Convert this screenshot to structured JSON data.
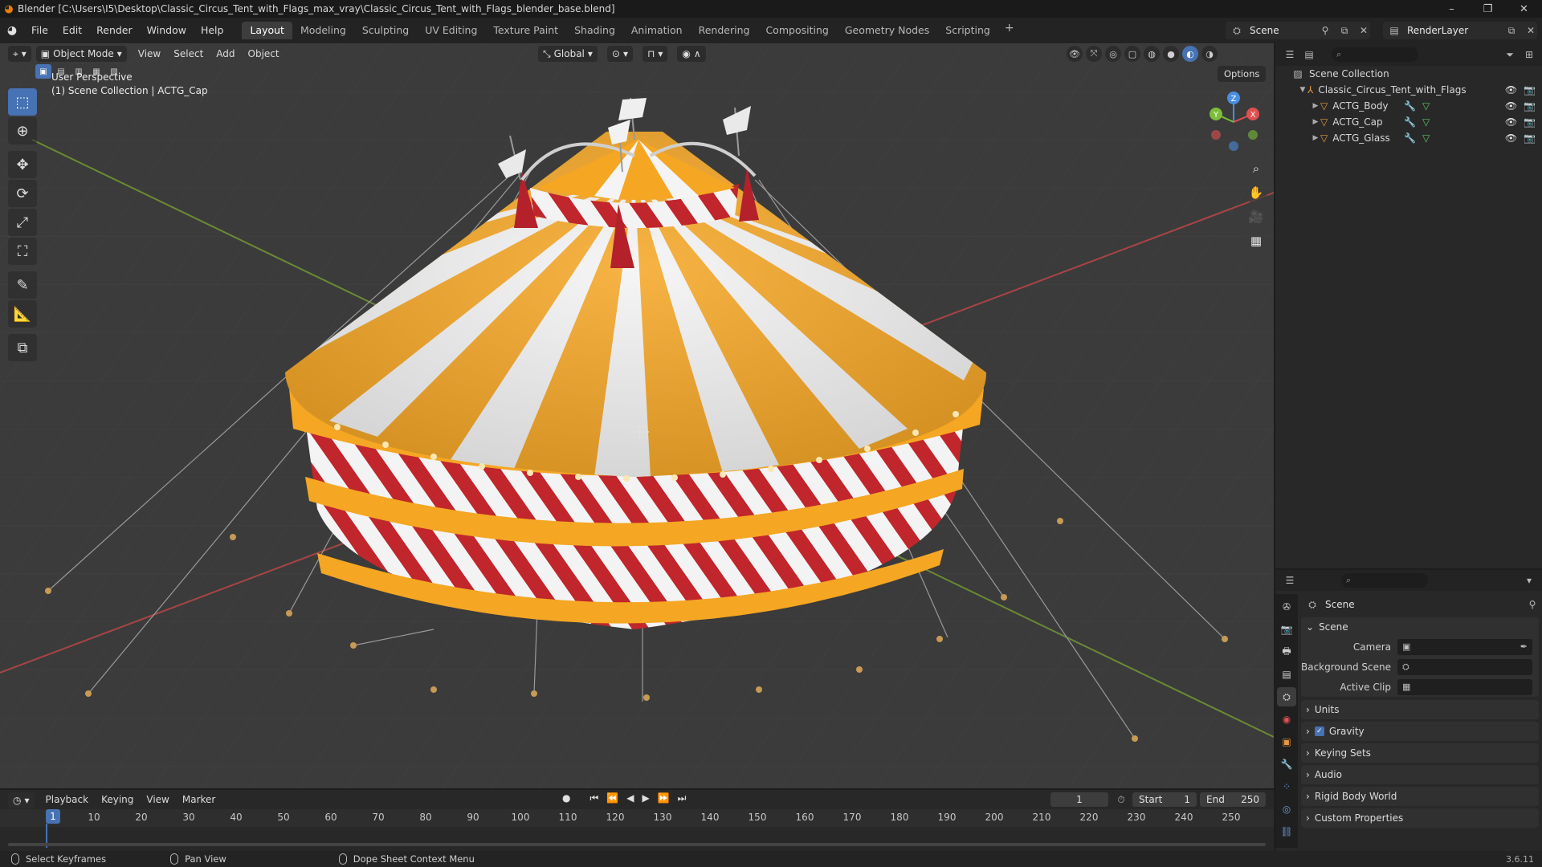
{
  "window": {
    "title": "Blender [C:\\Users\\I5\\Desktop\\Classic_Circus_Tent_with_Flags_max_vray\\Classic_Circus_Tent_with_Flags_blender_base.blend]",
    "controls": [
      "minimize",
      "maximize",
      "close"
    ]
  },
  "menu": [
    "File",
    "Edit",
    "Render",
    "Window",
    "Help"
  ],
  "workspaces": [
    "Layout",
    "Modeling",
    "Sculpting",
    "UV Editing",
    "Texture Paint",
    "Shading",
    "Animation",
    "Rendering",
    "Compositing",
    "Geometry Nodes",
    "Scripting"
  ],
  "active_workspace": "Layout",
  "scene_name": "Scene",
  "view_layer": "RenderLayer",
  "viewport": {
    "mode": "Object Mode",
    "menus": [
      "View",
      "Select",
      "Add",
      "Object"
    ],
    "orientation": "Global",
    "options_label": "Options",
    "info_line1": "User Perspective",
    "info_line2": "(1) Scene Collection | ACTG_Cap",
    "tools": [
      "select-box",
      "cursor",
      "move",
      "rotate",
      "scale",
      "transform",
      "annotate",
      "measure",
      "add-cube"
    ],
    "gizmo_axes": [
      "X",
      "Y",
      "Z"
    ]
  },
  "outliner": {
    "root": "Scene Collection",
    "collection": "Classic_Circus_Tent_with_Flags",
    "objects": [
      "ACTG_Body",
      "ACTG_Cap",
      "ACTG_Glass"
    ]
  },
  "properties": {
    "breadcrumb": "Scene",
    "panel_title": "Scene",
    "fields": [
      {
        "label": "Camera",
        "value": ""
      },
      {
        "label": "Background Scene",
        "value": ""
      },
      {
        "label": "Active Clip",
        "value": ""
      }
    ],
    "sections": [
      "Units",
      "Gravity",
      "Keying Sets",
      "Audio",
      "Rigid Body World",
      "Custom Properties"
    ],
    "gravity_enabled": true
  },
  "timeline": {
    "menus": [
      "Playback",
      "Keying",
      "View",
      "Marker"
    ],
    "current_frame": "1",
    "start_label": "Start",
    "start": "1",
    "end_label": "End",
    "end": "250",
    "ticks": [
      "10",
      "20",
      "30",
      "40",
      "50",
      "60",
      "70",
      "80",
      "90",
      "100",
      "110",
      "120",
      "130",
      "140",
      "150",
      "160",
      "170",
      "180",
      "190",
      "200",
      "210",
      "220",
      "230",
      "240",
      "250"
    ],
    "playhead": "1"
  },
  "statusbar": {
    "hint1": "Select Keyframes",
    "hint2": "Pan View",
    "hint3": "Dope Sheet Context Menu",
    "version": "3.6.11"
  },
  "colors": {
    "accent": "#4772b3",
    "tent_orange": "#f5a623",
    "tent_red": "#c0262b",
    "axis_x": "#e05050",
    "axis_y": "#7cbd3a",
    "axis_z": "#4a8ee0"
  }
}
